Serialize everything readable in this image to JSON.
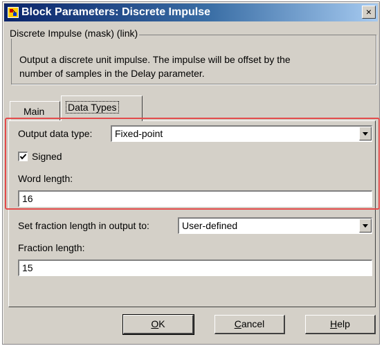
{
  "window": {
    "title": "Block Parameters: Discrete  Impulse",
    "close_label": "×"
  },
  "group": {
    "legend": "Discrete Impulse  (mask) (link)",
    "description_line1": "Output a discrete unit impulse.  The impulse will be offset by the",
    "description_line2": "number of samples in the Delay parameter."
  },
  "tabs": [
    {
      "label": "Main",
      "active": false
    },
    {
      "label": "Data Types",
      "active": true
    }
  ],
  "form": {
    "output_data_type_label": "Output data type:",
    "output_data_type_value": "Fixed-point",
    "signed_label": "Signed",
    "signed_checked": true,
    "word_length_label": "Word length:",
    "word_length_value": "16",
    "fraction_mode_label": "Set fraction length in output to:",
    "fraction_mode_value": "User-defined",
    "fraction_length_label": "Fraction length:",
    "fraction_length_value": "15"
  },
  "buttons": {
    "ok_mnemonic": "O",
    "ok_rest": "K",
    "cancel_mnemonic": "C",
    "cancel_rest": "ancel",
    "help_mnemonic": "H",
    "help_rest": "elp"
  },
  "colors": {
    "highlight": "#e34a4a",
    "titlebar_start": "#0a246a",
    "titlebar_end": "#a6caf0"
  }
}
